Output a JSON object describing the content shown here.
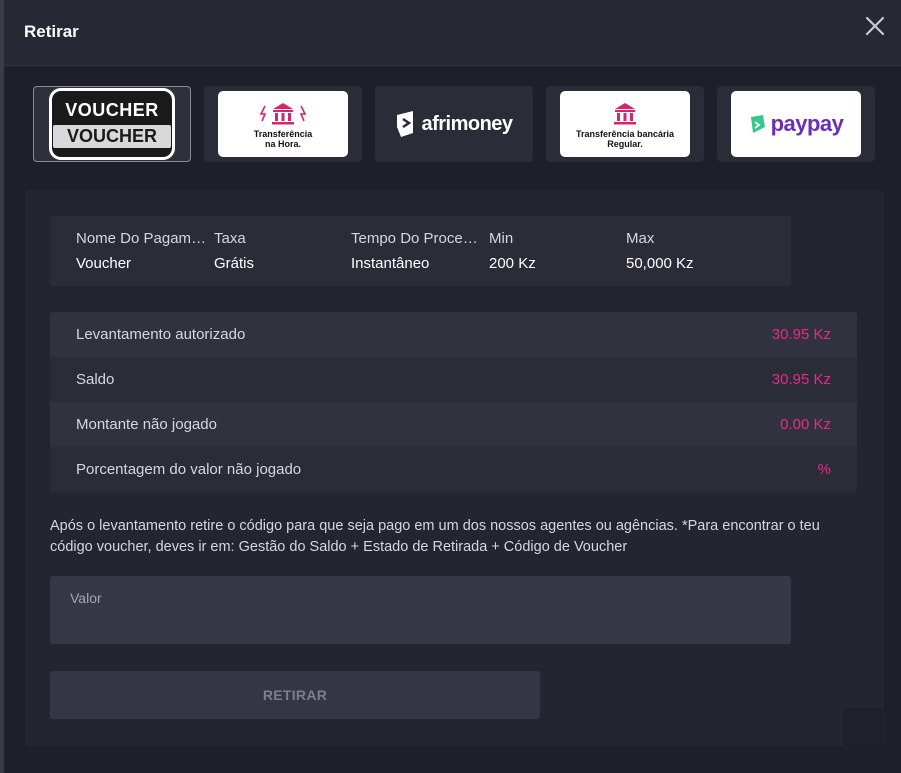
{
  "header": {
    "title": "Retirar",
    "close_icon": "close-icon"
  },
  "methods": [
    {
      "name": "voucher",
      "line1": "VOUCHER",
      "line2": "VOUCHER",
      "active": true
    },
    {
      "name": "transfer-now",
      "label": "Transferência\nna Hora.",
      "icon": "bank-icon"
    },
    {
      "name": "afrimoney",
      "label": "afrimoney",
      "icon": "afrimoney-icon"
    },
    {
      "name": "transfer-regular",
      "label": "Transferência bancária\nRegular.",
      "icon": "bank-icon"
    },
    {
      "name": "paypay",
      "label": "paypay",
      "icon": "paypay-icon"
    }
  ],
  "info": {
    "headers": [
      "Nome Do Pagamento",
      "Taxa",
      "Tempo Do Processamento",
      "Min",
      "Max"
    ],
    "values": [
      "Voucher",
      "Grátis",
      "Instantâneo",
      "200 Kz",
      "50,000 Kz"
    ]
  },
  "rows": [
    {
      "label": "Levantamento autorizado",
      "value": "30.95 Kz"
    },
    {
      "label": "Saldo",
      "value": "30.95 Kz"
    },
    {
      "label": "Montante não jogado",
      "value": "0.00 Kz"
    },
    {
      "label": "Porcentagem do valor não jogado",
      "value": "%"
    }
  ],
  "note": "Após o levantamento retire o código para que seja pago em um dos nossos agentes ou agências. *Para encontrar o teu código voucher, deves ir em: Gestão do Saldo + Estado de Retirada + Código de Voucher",
  "amount_field": {
    "label": "Valor",
    "value": ""
  },
  "submit_label": "RETIRAR",
  "colors": {
    "accent": "#e8298a",
    "bank_pink": "#d6246e",
    "paypay_purple": "#6a2fb6",
    "paypay_green": "#34c88a"
  }
}
